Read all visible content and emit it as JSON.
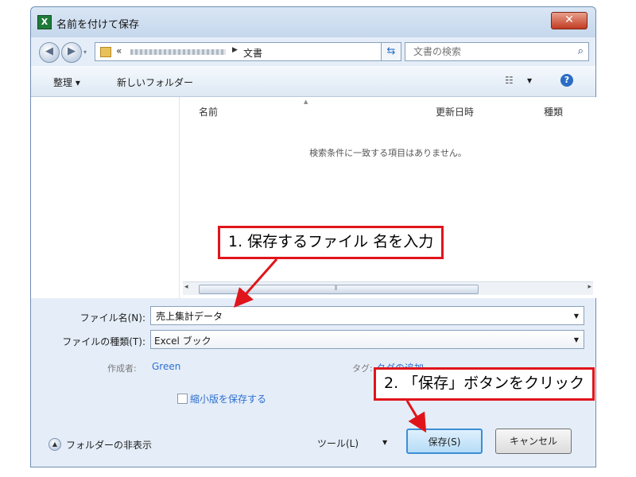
{
  "window": {
    "title": "名前を付けて保存",
    "app_icon": "X",
    "close_glyph": "✕"
  },
  "address": {
    "prefix": "«",
    "current": "文書",
    "search_placeholder": "文書の検索"
  },
  "toolbar": {
    "organize_label": "整理 ▾",
    "new_folder_label": "新しいフォルダー",
    "views_glyph": "☷",
    "help_glyph": "?"
  },
  "filelist": {
    "columns": [
      "名前",
      "更新日時",
      "種類"
    ],
    "empty_message": "検索条件に一致する項目はありません。"
  },
  "form": {
    "filename_label": "ファイル名(N):",
    "filename_value": "売上集計データ",
    "filetype_label": "ファイルの種類(T):",
    "filetype_value": "Excel ブック",
    "author_label": "作成者:",
    "author_value": "Green",
    "tag_label": "タグ:",
    "tag_value": "タグの追加",
    "thumbnail_label": "縮小版を保存する"
  },
  "footer": {
    "hide_folders_label": "フォルダーの非表示",
    "tools_label": "ツール(L)",
    "save_label": "保存(S)",
    "cancel_label": "キャンセル"
  },
  "annotations": {
    "step1": "1. 保存するファイル 名を入力",
    "step2": "2. 「保存」ボタンをクリック"
  },
  "colors": {
    "callout_border": "#e0151b",
    "link": "#2f6fd0",
    "save_button_border": "#3c8ed6"
  }
}
